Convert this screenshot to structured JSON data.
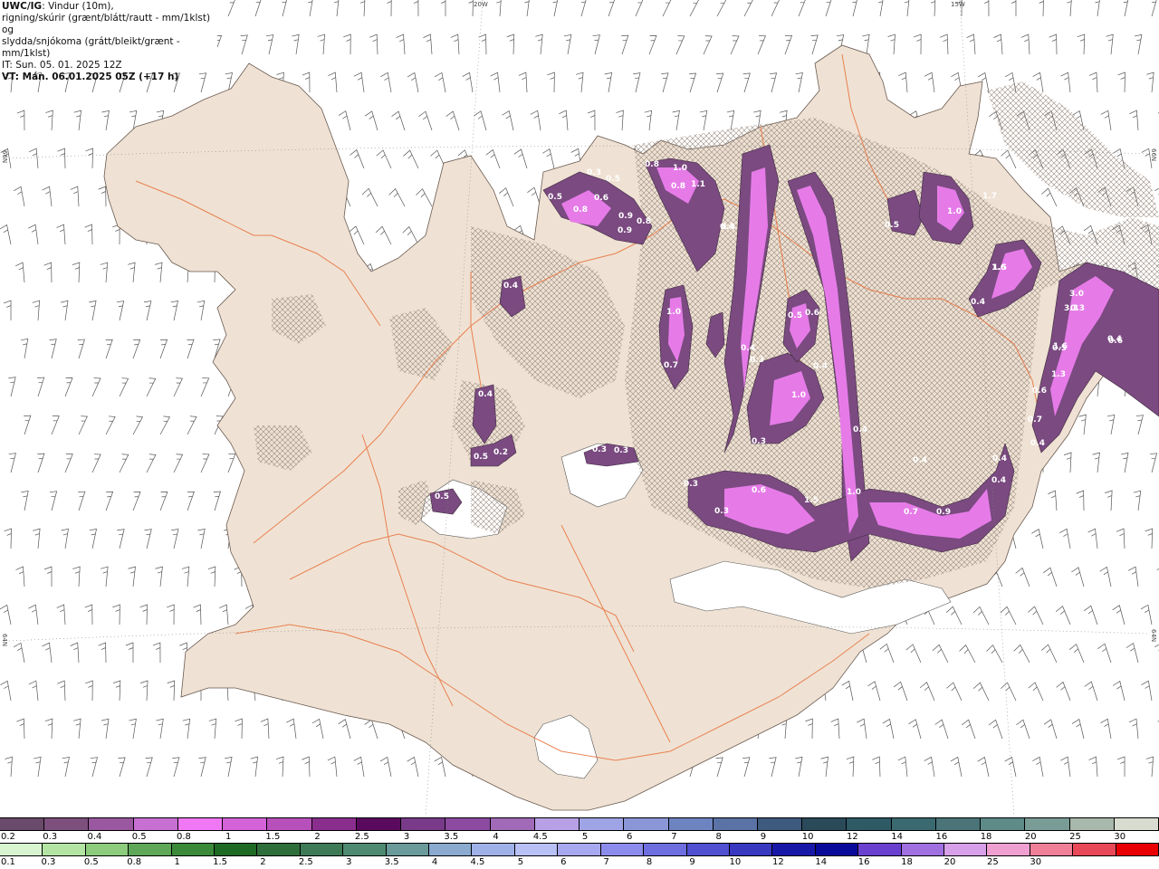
{
  "title": {
    "model": "UWC/IG",
    "line1_rest": ": Vindur (10m),",
    "line2": "rigning/skúrir (grænt/blátt/rautt - mm/1klst) og",
    "line3": "slydda/snjókoma (grátt/bleikt/grænt - mm/1klst)",
    "init": "IT: Sun. 05. 01. 2025 12Z",
    "valid": "VT: Mán. 06.01.2025 05Z (+17 h)"
  },
  "graticule": {
    "top_left": "20W",
    "top_right": "15W",
    "left_upper": "66N",
    "left_lower": "64N",
    "right_upper": "66N",
    "right_lower": "64N"
  },
  "colors": {
    "land": "#efe2d4",
    "roads": "#e8703a",
    "ocean": "#ffffff",
    "barbs": "#555555"
  },
  "precip_labels": [
    {
      "v": "0.3"
    },
    {
      "v": "0.5"
    },
    {
      "v": "0.5"
    },
    {
      "v": "0.6"
    },
    {
      "v": "0.8"
    },
    {
      "v": "0.9"
    },
    {
      "v": "0.8"
    },
    {
      "v": "0.9"
    },
    {
      "v": "1.0"
    },
    {
      "v": "0.8"
    },
    {
      "v": "1.1"
    },
    {
      "v": "0.8"
    },
    {
      "v": "0.4"
    },
    {
      "v": "1.7"
    },
    {
      "v": "0.5"
    },
    {
      "v": "1.6"
    },
    {
      "v": "0.3"
    },
    {
      "v": "0.6"
    },
    {
      "v": "0.5"
    },
    {
      "v": "1.0"
    },
    {
      "v": "1.5"
    },
    {
      "v": "0.4"
    },
    {
      "v": "3.0"
    },
    {
      "v": "3.3"
    },
    {
      "v": "1.6"
    },
    {
      "v": "1.3"
    },
    {
      "v": "0.6"
    },
    {
      "v": "0.7"
    },
    {
      "v": "0.4"
    },
    {
      "v": "0.4"
    },
    {
      "v": "0.4"
    },
    {
      "v": "1.0"
    },
    {
      "v": "0.7"
    },
    {
      "v": "0.4"
    },
    {
      "v": "0.4"
    },
    {
      "v": "0.4"
    },
    {
      "v": "0.3"
    },
    {
      "v": "0.6"
    },
    {
      "v": "0.4"
    },
    {
      "v": "1.0"
    },
    {
      "v": "0.3"
    },
    {
      "v": "0.4"
    },
    {
      "v": "0.4"
    },
    {
      "v": "0.3"
    },
    {
      "v": "0.5"
    },
    {
      "v": "0.6"
    },
    {
      "v": "1.5"
    },
    {
      "v": "1.0"
    },
    {
      "v": "0.7"
    },
    {
      "v": "0.9"
    },
    {
      "v": "0.4"
    },
    {
      "v": "0.3"
    },
    {
      "v": "0.2"
    },
    {
      "v": "0.5"
    },
    {
      "v": "0.3"
    },
    {
      "v": "0.3"
    },
    {
      "v": "0.5"
    },
    {
      "v": "0.4"
    }
  ],
  "legend_snow": {
    "colors": [
      "#6a4a6a",
      "#7d4f7d",
      "#9a58a0",
      "#c86fd2",
      "#f078f5",
      "#d462d8",
      "#b850bc",
      "#8a2e8e",
      "#5a0a5e",
      "#7a3a8a",
      "#8c4aa0",
      "#a06ab8",
      "#b8a0e6",
      "#9fa4e6",
      "#8a96d6",
      "#6e84c0",
      "#5a72a6",
      "#3e5a7e",
      "#2a4a5a",
      "#2e5a66",
      "#3a6a70",
      "#4a7478",
      "#5e8a88",
      "#7a9c96",
      "#a8b8ac",
      "#d8dcd0"
    ],
    "labels": [
      "0.2",
      "0.3",
      "0.4",
      "0.5",
      "0.8",
      "1",
      "1.5",
      "2",
      "2.5",
      "3",
      "3.5",
      "4",
      "4.5",
      "5",
      "6",
      "7",
      "8",
      "9",
      "10",
      "12",
      "14",
      "16",
      "18",
      "20",
      "25",
      "30"
    ]
  },
  "legend_rain": {
    "colors": [
      "#d8f5d0",
      "#b4e4a4",
      "#8ccc7c",
      "#5ea858",
      "#3a8a3a",
      "#1e6a24",
      "#2e6e3a",
      "#3e7a56",
      "#4e8a72",
      "#6a9a9a",
      "#8aaad0",
      "#a0b0e8",
      "#b8c0f5",
      "#a8a8f0",
      "#8c8cec",
      "#6e6ee0",
      "#5050d0",
      "#3838c0",
      "#1818a8",
      "#0a0a9a",
      "#6a40d0",
      "#a070e0",
      "#d8a0e8",
      "#f0a0d0",
      "#f08098",
      "#e84858",
      "#e80000"
    ],
    "labels": [
      "0.1",
      "0.3",
      "0.5",
      "0.8",
      "1",
      "1.5",
      "2",
      "2.5",
      "3",
      "3.5",
      "4",
      "4.5",
      "5",
      "6",
      "7",
      "8",
      "9",
      "10",
      "12",
      "14",
      "16",
      "18",
      "20",
      "25",
      "30"
    ]
  }
}
